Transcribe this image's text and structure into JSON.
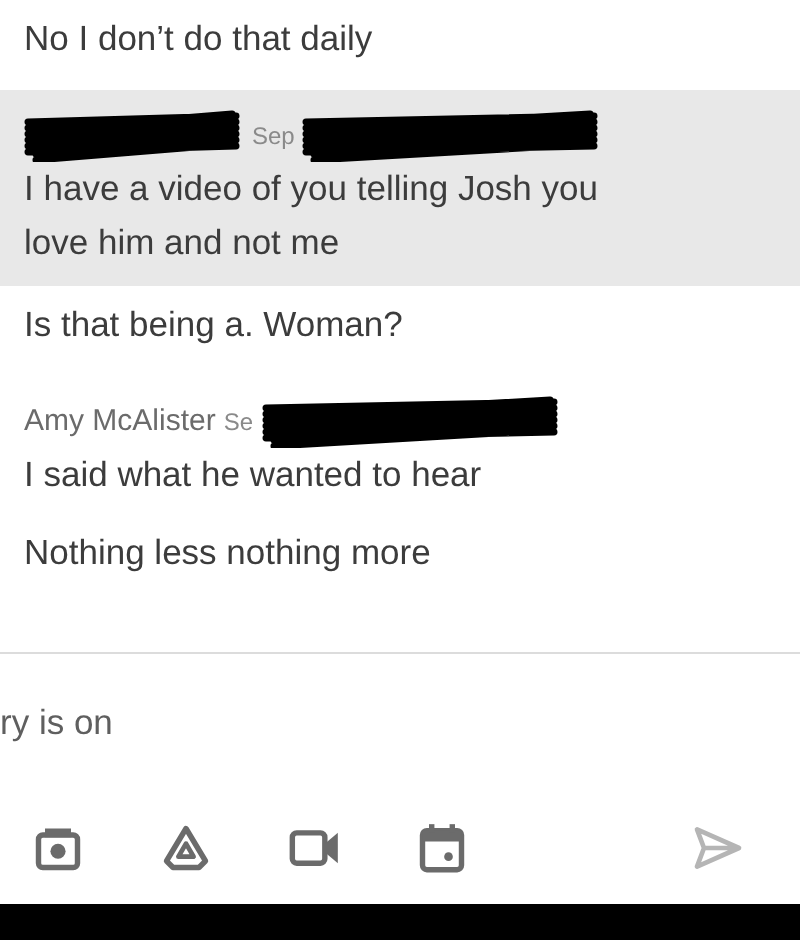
{
  "groups": [
    {
      "messages": [
        {
          "text": "No I don’t do that daily",
          "selected": false
        }
      ]
    },
    {
      "sender_redacted": true,
      "time": "Sep",
      "time_redacted": true,
      "messages": [
        {
          "text": "I have a video of you telling Josh you love him and not me",
          "selected": true
        },
        {
          "text": "Is that being a. Woman?",
          "selected": false
        }
      ]
    },
    {
      "sender": "Amy McAlister",
      "sender_redacted": false,
      "time": "Se",
      "time_redacted": true,
      "messages": [
        {
          "text": "I said what he wanted to hear",
          "selected": false
        },
        {
          "text": "Nothing less nothing more",
          "selected": false
        }
      ]
    }
  ],
  "composer": {
    "placeholder": "ry is on"
  },
  "toolbar": [
    {
      "kind": "camera"
    },
    {
      "kind": "drive"
    },
    {
      "kind": "video"
    },
    {
      "kind": "calendar"
    }
  ],
  "send": {
    "disabled": true
  }
}
